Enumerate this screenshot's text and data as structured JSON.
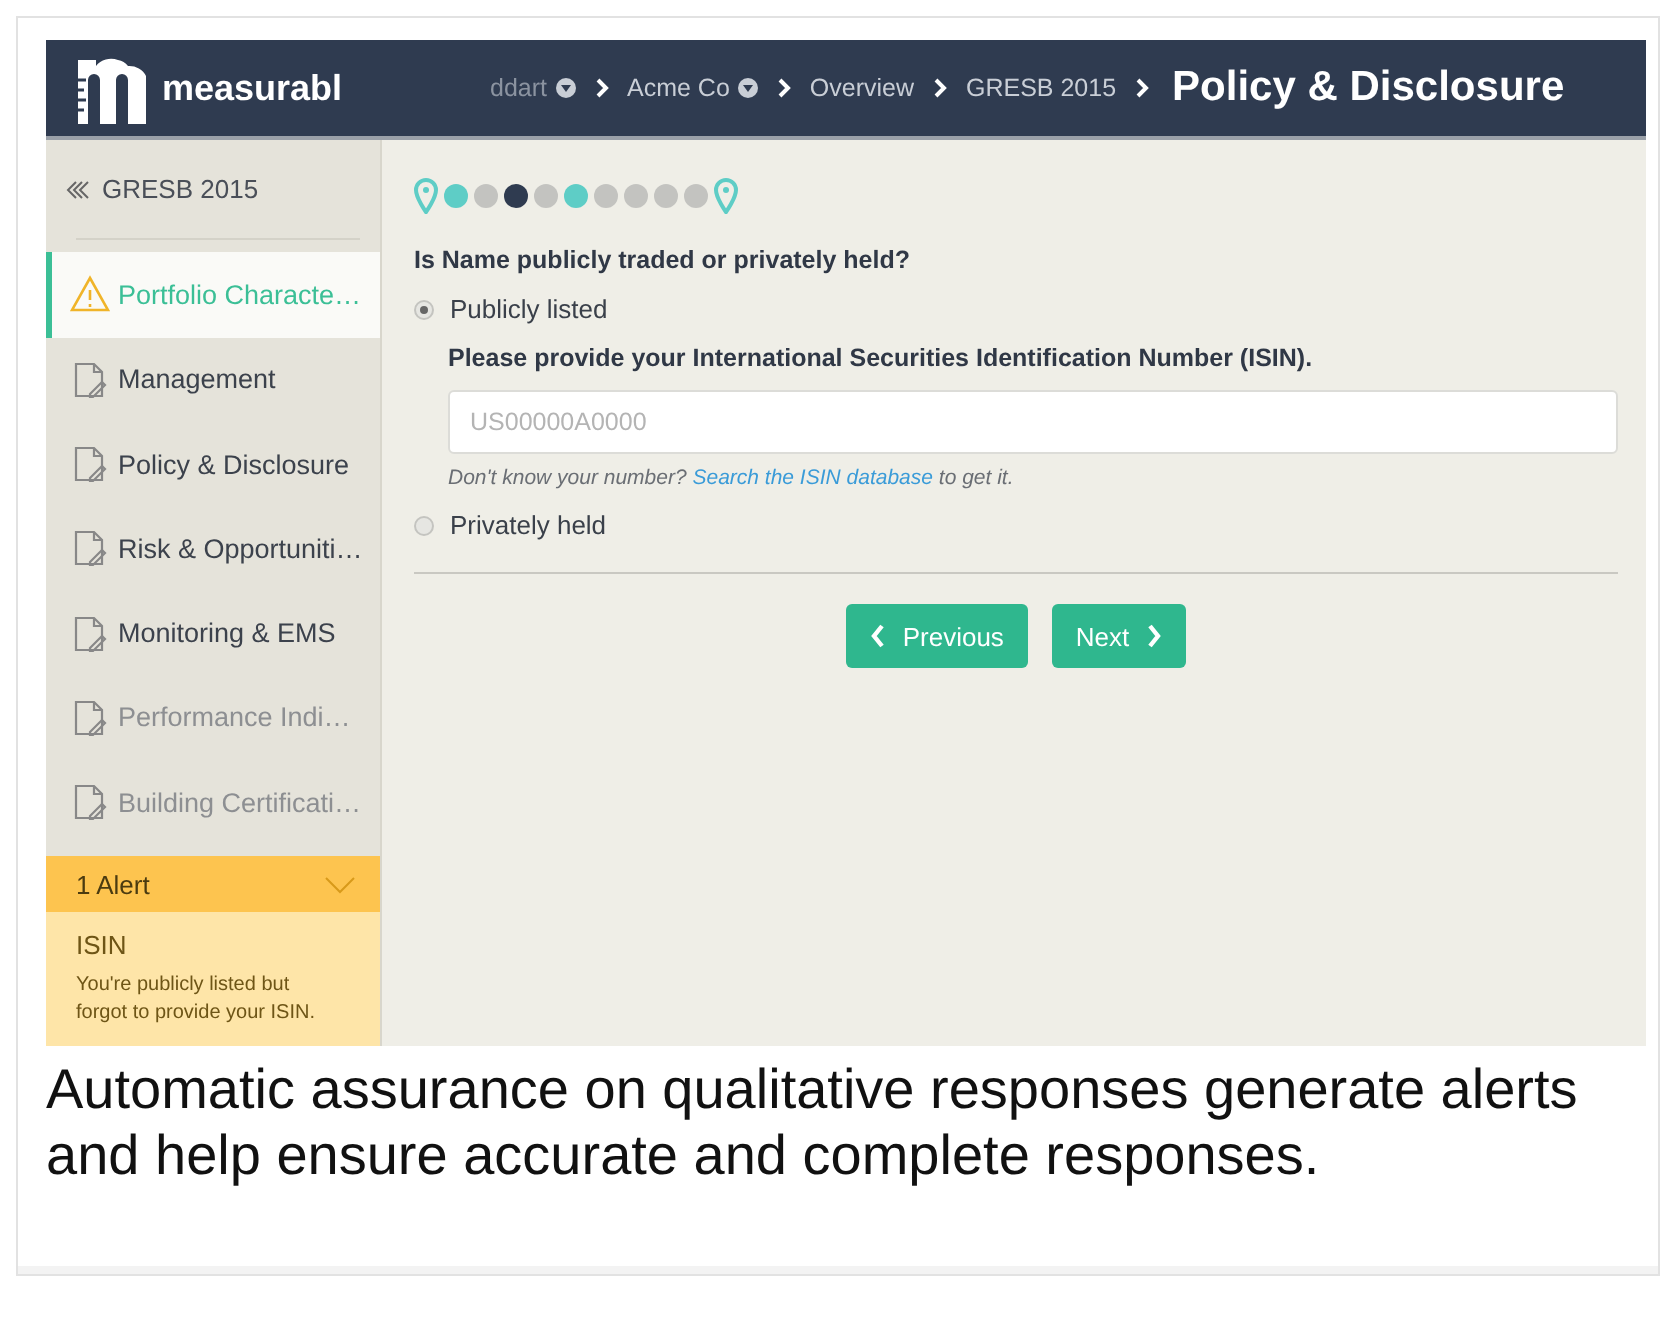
{
  "header": {
    "logo": "measurabl",
    "breadcrumbs": [
      {
        "label": "ddart",
        "dropdown": true
      },
      {
        "label": "Acme Co",
        "dropdown": true
      },
      {
        "label": "Overview",
        "dropdown": false
      },
      {
        "label": "GRESB 2015",
        "dropdown": false
      }
    ],
    "title": "Policy & Disclosure"
  },
  "sidebar": {
    "back": "GRESB 2015",
    "items": [
      {
        "label": "Portfolio Characte…",
        "kind": "warning",
        "selected": true,
        "disabled": false
      },
      {
        "label": "Management",
        "kind": "document",
        "selected": false,
        "disabled": false
      },
      {
        "label": "Policy & Disclosure",
        "kind": "document",
        "selected": false,
        "disabled": false
      },
      {
        "label": "Risk & Opportuniti…",
        "kind": "document",
        "selected": false,
        "disabled": false
      },
      {
        "label": "Monitoring & EMS",
        "kind": "document",
        "selected": false,
        "disabled": false
      },
      {
        "label": "Performance Indi…",
        "kind": "document",
        "selected": false,
        "disabled": true
      },
      {
        "label": "Building Certificati…",
        "kind": "document",
        "selected": false,
        "disabled": true
      }
    ],
    "alert": {
      "title": "1 Alert",
      "expanded": true,
      "items": [
        {
          "field": "ISIN",
          "message": "You're publicly listed but forgot to provide your ISIN."
        }
      ]
    }
  },
  "progress": [
    {
      "kind": "pin"
    },
    {
      "kind": "done"
    },
    {
      "kind": "pending"
    },
    {
      "kind": "current"
    },
    {
      "kind": "pending"
    },
    {
      "kind": "done"
    },
    {
      "kind": "pending"
    },
    {
      "kind": "pending"
    },
    {
      "kind": "pending"
    },
    {
      "kind": "pending"
    },
    {
      "kind": "pin"
    }
  ],
  "form": {
    "question": "Is Name publicly traded or privately held?",
    "options": [
      {
        "label": "Publicly listed",
        "selected": true
      },
      {
        "label": "Privately held",
        "selected": false
      }
    ],
    "followup": {
      "label": "Please provide your International Securities Identification Number (ISIN).",
      "placeholder": "US00000A0000",
      "help_before": "Don't know your number?",
      "help_link": "Search the ISIN database",
      "help_after": "to get it."
    },
    "buttons": [
      {
        "label": "Previous",
        "kind": "previous"
      },
      {
        "label": "Next",
        "kind": "next"
      }
    ]
  },
  "caption": "Automatic assurance on qualitative responses generate alerts and help ensure accurate and complete responses."
}
